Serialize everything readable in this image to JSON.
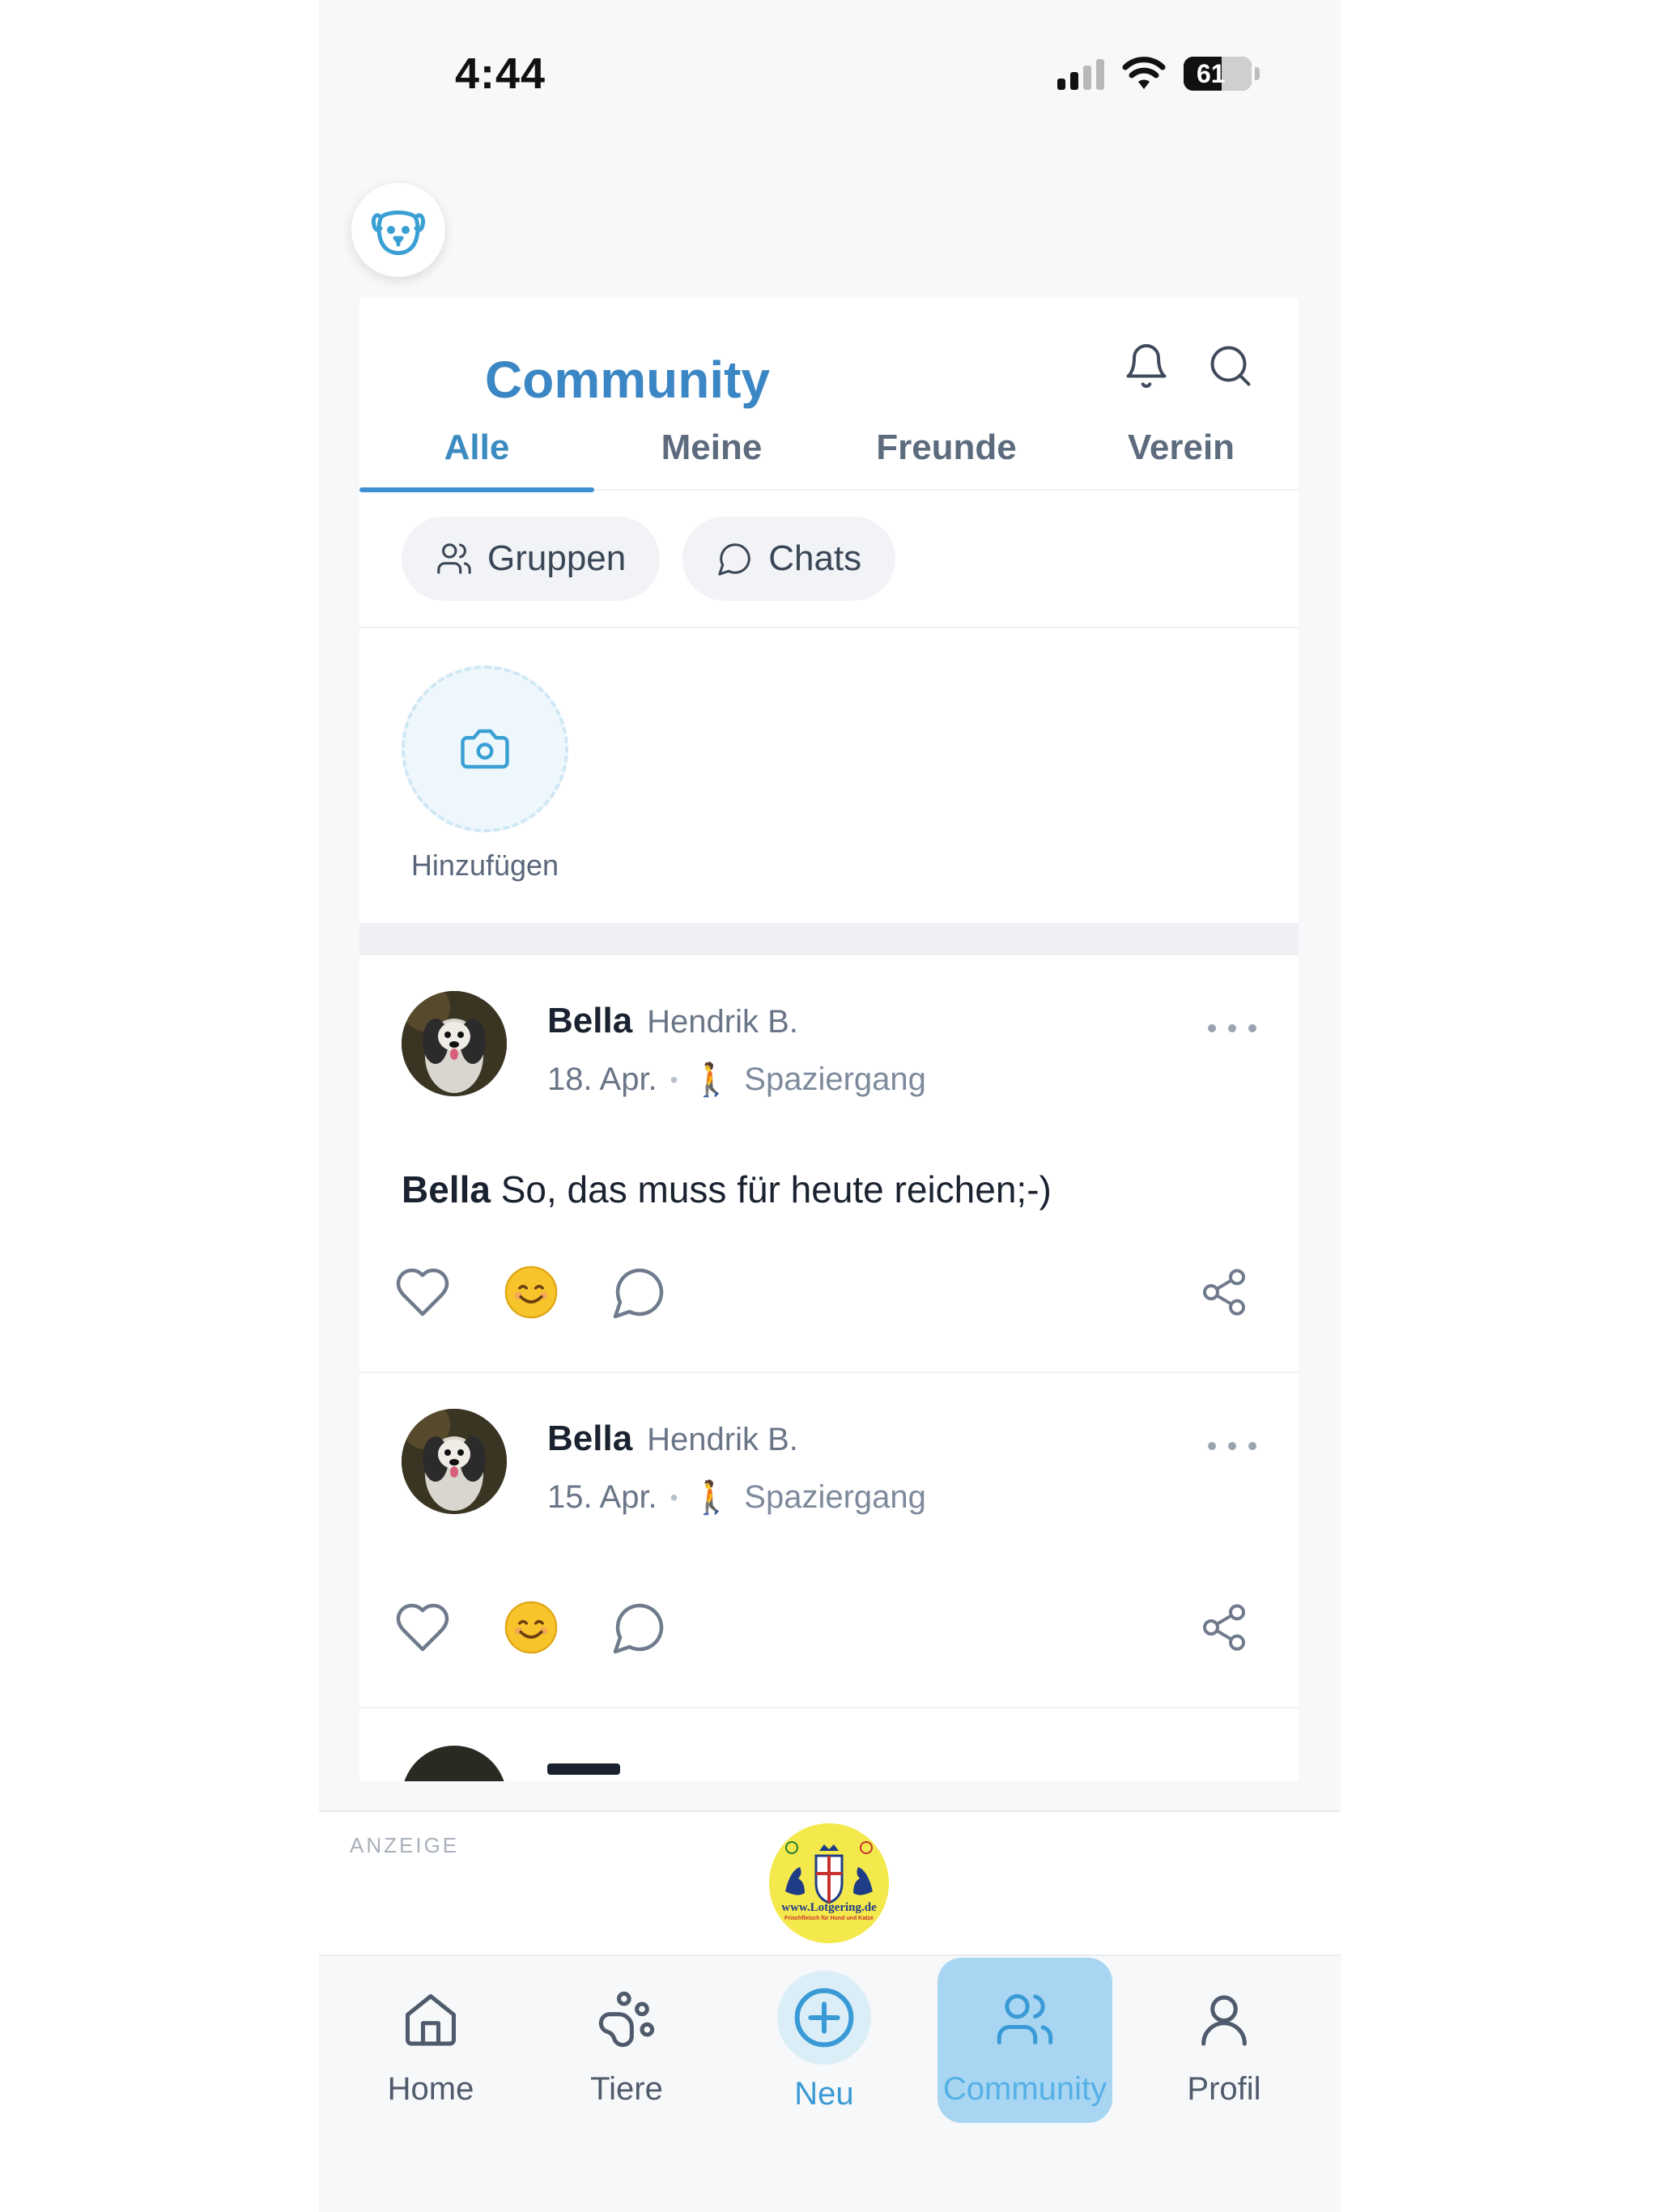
{
  "status_bar": {
    "time": "4:44",
    "battery": "61"
  },
  "header": {
    "title": "Community"
  },
  "tabs": [
    {
      "label": "Alle",
      "active": true
    },
    {
      "label": "Meine",
      "active": false
    },
    {
      "label": "Freunde",
      "active": false
    },
    {
      "label": "Verein",
      "active": false
    }
  ],
  "chips": {
    "groups": "Gruppen",
    "chats": "Chats"
  },
  "stories": {
    "add_label": "Hinzufügen"
  },
  "posts": [
    {
      "pet": "Bella",
      "owner": "Hendrik B.",
      "date": "18. Apr.",
      "category": "Spaziergang",
      "category_emoji": "🚶",
      "text_name": "Bella",
      "text": "So, das muss für heute reichen;-)"
    },
    {
      "pet": "Bella",
      "owner": "Hendrik B.",
      "date": "15. Apr.",
      "category": "Spaziergang",
      "category_emoji": "🚶"
    }
  ],
  "ad": {
    "label": "ANZEIGE",
    "logo_text": "www.Lotgering.de",
    "logo_subtext": "Frischfleisch für Hund und Katze"
  },
  "bottom_nav": [
    {
      "label": "Home",
      "icon": "home-icon"
    },
    {
      "label": "Tiere",
      "icon": "paw-icon"
    },
    {
      "label": "Neu",
      "icon": "plus-circle-icon"
    },
    {
      "label": "Community",
      "icon": "users-icon",
      "active": true
    },
    {
      "label": "Profil",
      "icon": "user-icon"
    }
  ],
  "colors": {
    "accent": "#3b86c4",
    "tab_active": "#3a8bbf",
    "nav_active_bg": "#a8d6f2",
    "emoji_face": "#f7c52b"
  }
}
